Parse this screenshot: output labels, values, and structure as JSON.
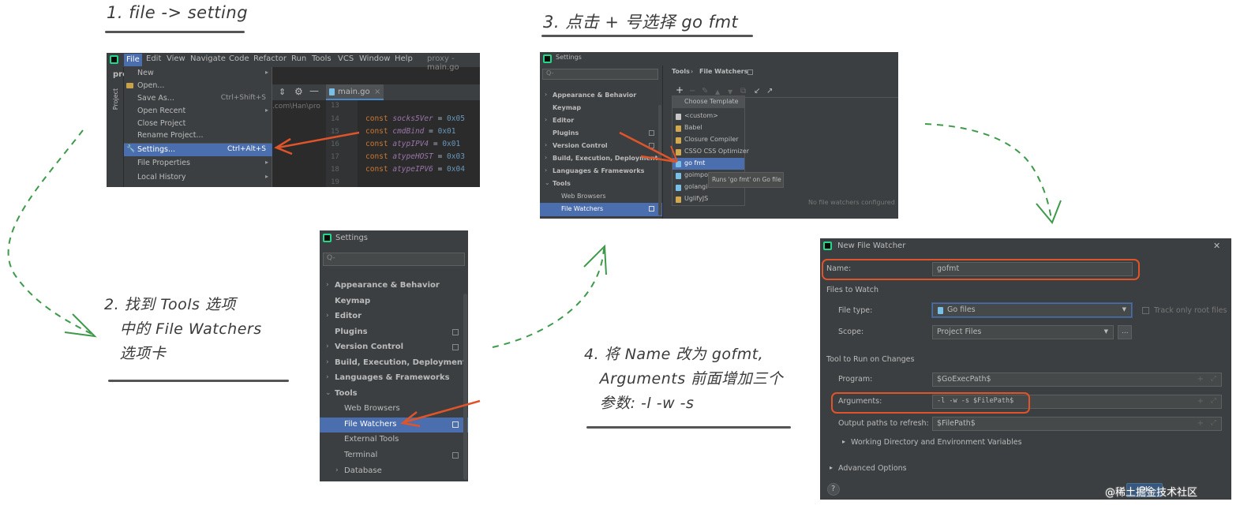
{
  "steps": {
    "s1_title": "1. file -> setting",
    "s2_lines": [
      "2. 找到 Tools 选项",
      "   中的 File Watchers",
      "   选项卡"
    ],
    "s3_title": "3. 点击 + 号选择 go fmt",
    "s4_lines": [
      "4. 将 Name 改为 gofmt,",
      "   Arguments 前面增加三个",
      "   参数: -l -w -s"
    ]
  },
  "screen1": {
    "menubar": [
      "File",
      "Edit",
      "View",
      "Navigate",
      "Code",
      "Refactor",
      "Run",
      "Tools",
      "VCS",
      "Window",
      "Help"
    ],
    "window_title": "proxy - main.go",
    "sidebar_label": "Project",
    "left_stub": "prc",
    "file_menu": [
      {
        "label": "New",
        "shortcut": "",
        "arrow": "▸"
      },
      {
        "label": "Open...",
        "shortcut": "",
        "arrow": ""
      },
      {
        "label": "Save As...",
        "shortcut": "Ctrl+Shift+S",
        "arrow": ""
      },
      {
        "label": "Open Recent",
        "shortcut": "",
        "arrow": "▸"
      },
      {
        "label": "Close Project",
        "shortcut": "",
        "arrow": ""
      },
      {
        "label": "Rename Project...",
        "shortcut": "",
        "arrow": ""
      },
      {
        "label": "Settings...",
        "shortcut": "Ctrl+Alt+S",
        "arrow": ""
      },
      {
        "label": "File Properties",
        "shortcut": "",
        "arrow": "▸"
      },
      {
        "label": "Local History",
        "shortcut": "",
        "arrow": "▸"
      }
    ],
    "tab": "main.go",
    "path_fragment": ".com\\Han\\pro",
    "line_numbers": [
      "13",
      "14",
      "15",
      "16",
      "17",
      "18",
      "19"
    ],
    "code": [
      {
        "kw": "const",
        "name": "socks5Ver",
        "val": "0x05"
      },
      {
        "kw": "const",
        "name": "cmdBind",
        "val": "0x01"
      },
      {
        "kw": "const",
        "name": "atypIPV4",
        "val": "0x01"
      },
      {
        "kw": "const",
        "name": "atypeHOST",
        "val": "0x03"
      },
      {
        "kw": "const",
        "name": "atypeIPV6",
        "val": "0x04"
      }
    ]
  },
  "screen2": {
    "title": "Settings",
    "search_placeholder": "Q-",
    "items": [
      {
        "label": "Appearance & Behavior",
        "chev": "›",
        "bold": true
      },
      {
        "label": "Keymap",
        "chev": "",
        "bold": true
      },
      {
        "label": "Editor",
        "chev": "›",
        "bold": true
      },
      {
        "label": "Plugins",
        "chev": "",
        "bold": true
      },
      {
        "label": "Version Control",
        "chev": "›",
        "bold": true
      },
      {
        "label": "Build, Execution, Deployment",
        "chev": "›",
        "bold": true
      },
      {
        "label": "Languages & Frameworks",
        "chev": "›",
        "bold": true
      },
      {
        "label": "Tools",
        "chev": "⌄",
        "bold": true
      },
      {
        "label": "Web Browsers",
        "chev": "",
        "bold": false
      },
      {
        "label": "File Watchers",
        "chev": "",
        "bold": false
      },
      {
        "label": "External Tools",
        "chev": "",
        "bold": false
      },
      {
        "label": "Terminal",
        "chev": "",
        "bold": false
      },
      {
        "label": "Database",
        "chev": "›",
        "bold": false
      }
    ]
  },
  "screen3": {
    "title": "Settings",
    "search_placeholder": "Q-",
    "breadcrumb": [
      "Tools",
      "File Watchers"
    ],
    "items": [
      {
        "label": "Appearance & Behavior",
        "chev": "›"
      },
      {
        "label": "Keymap",
        "chev": ""
      },
      {
        "label": "Editor",
        "chev": "›"
      },
      {
        "label": "Plugins",
        "chev": ""
      },
      {
        "label": "Version Control",
        "chev": "›"
      },
      {
        "label": "Build, Execution, Deployment",
        "chev": "›"
      },
      {
        "label": "Languages & Frameworks",
        "chev": "›"
      },
      {
        "label": "Tools",
        "chev": "⌄"
      },
      {
        "label": "Web Browsers",
        "chev": ""
      },
      {
        "label": "File Watchers",
        "chev": ""
      }
    ],
    "toolbar": [
      "+",
      "−",
      "✎",
      "▲",
      "▼",
      "⧉",
      "↙",
      "↗"
    ],
    "popup_header": "Choose Template",
    "templates": [
      "<custom>",
      "Babel",
      "Closure Compiler",
      "CSSO CSS Optimizer",
      "go fmt",
      "goimpo",
      "golangi",
      "UglifyJS"
    ],
    "tooltip": "Runs 'go fmt' on Go file",
    "empty_text": "No file watchers configured"
  },
  "screen4": {
    "title": "New File Watcher",
    "close": "✕",
    "name_label": "Name:",
    "name_value": "gofmt",
    "files_section": "Files to Watch",
    "filetype_label": "File type:",
    "filetype_value": "Go files",
    "track_label": "Track only root files",
    "scope_label": "Scope:",
    "scope_value": "Project Files",
    "scope_btn": "...",
    "tool_section": "Tool to Run on Changes",
    "program_label": "Program:",
    "program_value": "$GoExecPath$",
    "args_label": "Arguments:",
    "args_value": "-l -w -s $FilePath$",
    "output_label": "Output paths to refresh:",
    "output_value": "$FilePath$",
    "workdir_label": "Working Directory and Environment Variables",
    "advanced_label": "Advanced Options",
    "help": "?",
    "ok": "OK",
    "watermark": "@稀土掘金技术社区"
  },
  "colors": {
    "ide_bg": "#3c3f41",
    "selection": "#4b6eaf",
    "arrow_red": "#e0542a",
    "dash_green": "#3e9a4a"
  }
}
